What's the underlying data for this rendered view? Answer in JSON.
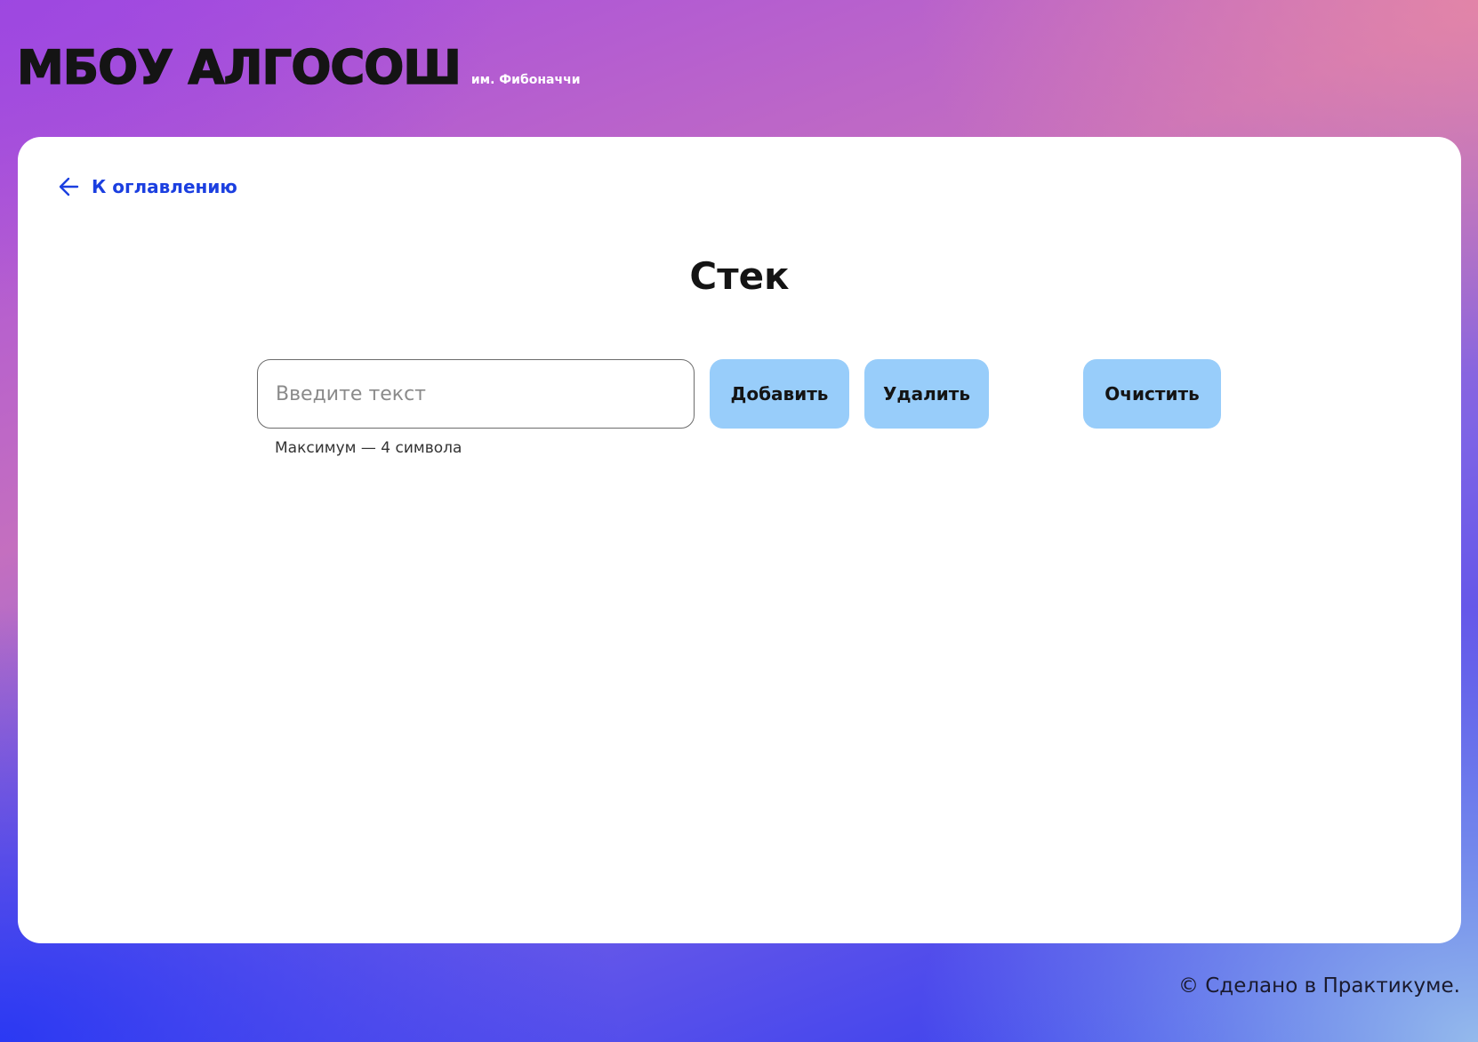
{
  "header": {
    "logo": "МБОУ АЛГОСОШ",
    "subtitle": "им. Фибоначчи"
  },
  "nav": {
    "back_label": "К оглавлению",
    "back_icon": "arrow-left-icon"
  },
  "page": {
    "title": "Стек"
  },
  "form": {
    "input_value": "",
    "input_placeholder": "Введите текст",
    "hint": "Максимум — 4 символа",
    "add_label": "Добавить",
    "remove_label": "Удалить",
    "clear_label": "Очистить"
  },
  "footer": {
    "text": "© Сделано в Практикуме."
  },
  "colors": {
    "accent": "#1b3fe0",
    "button_bg": "#98cdfa",
    "text": "#141414"
  }
}
